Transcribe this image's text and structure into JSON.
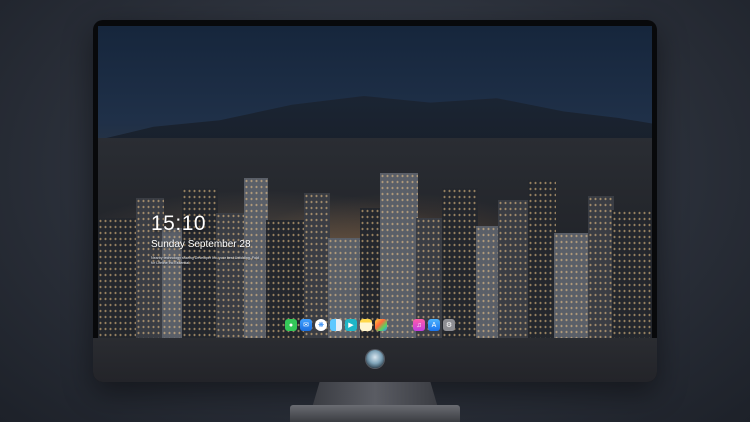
{
  "lockscreen": {
    "time": "15:10",
    "date": "Sunday September 28",
    "caption": "Nearby technology sharing Developer Inc. your best Unfolding. Fold for Lifeline Inc Essential"
  },
  "dock": {
    "apps": [
      {
        "name": "messages-icon"
      },
      {
        "name": "mail-icon"
      },
      {
        "name": "safari-icon"
      },
      {
        "name": "finder-icon"
      },
      {
        "name": "clapper-icon"
      },
      {
        "name": "notes-icon"
      },
      {
        "name": "photos-icon"
      },
      {
        "name": "music-icon"
      },
      {
        "name": "app-store-icon"
      },
      {
        "name": "settings-icon"
      }
    ]
  },
  "colors": {
    "background": "#2b303a",
    "bezel": "#08090b",
    "chin": "#2a2c31"
  }
}
